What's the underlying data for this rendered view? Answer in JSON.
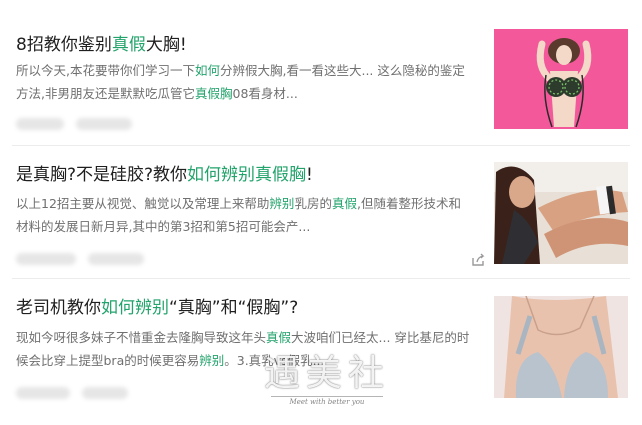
{
  "results": [
    {
      "title": [
        {
          "text": "8招教你鉴别",
          "hl": false
        },
        {
          "text": "真假",
          "hl": true
        },
        {
          "text": "大胸!",
          "hl": false
        }
      ],
      "snippet": [
        {
          "text": "所以今天,本花要带你们学习一下",
          "hl": false
        },
        {
          "text": "如何",
          "hl": true
        },
        {
          "text": "分辨假大胸,看一看这些大... 这么隐秘的鉴定方法,非男朋友还是默默吃瓜管它",
          "hl": false
        },
        {
          "text": "真假胸",
          "hl": true
        },
        {
          "text": "08看身材...",
          "hl": false
        }
      ]
    },
    {
      "title": [
        {
          "text": "是真胸?不是硅胶?教你",
          "hl": false
        },
        {
          "text": "如何辨别真假胸",
          "hl": true
        },
        {
          "text": "!",
          "hl": false
        }
      ],
      "snippet": [
        {
          "text": "以上12招主要从视觉、触觉以及常理上来帮助",
          "hl": false
        },
        {
          "text": "辨别",
          "hl": true
        },
        {
          "text": "乳房的",
          "hl": false
        },
        {
          "text": "真假",
          "hl": true
        },
        {
          "text": ",但随着整形技术和材料的发展日新月异,其中的第3招和第5招可能会产...",
          "hl": false
        }
      ]
    },
    {
      "title": [
        {
          "text": "老司机教你",
          "hl": false
        },
        {
          "text": "如何辨别",
          "hl": true
        },
        {
          "text": "“真胸”和“假胸”?",
          "hl": false
        }
      ],
      "snippet": [
        {
          "text": "现如今呀很多妹子不惜重金去隆胸导致这年头",
          "hl": false
        },
        {
          "text": "真假",
          "hl": true
        },
        {
          "text": "大波咱们已经太... 穿比基尼的时候会比穿上提型bra的时候更容易",
          "hl": false
        },
        {
          "text": "辨别",
          "hl": true
        },
        {
          "text": "。3.真乳vs假乳...",
          "hl": false
        }
      ]
    }
  ],
  "watermark": {
    "main": "遇美社",
    "sub": "Meet with better you"
  },
  "icons": {
    "share": "share-icon"
  },
  "colors": {
    "highlight": "#22a36b",
    "title": "#1f1f1f",
    "snippet": "#707070"
  }
}
